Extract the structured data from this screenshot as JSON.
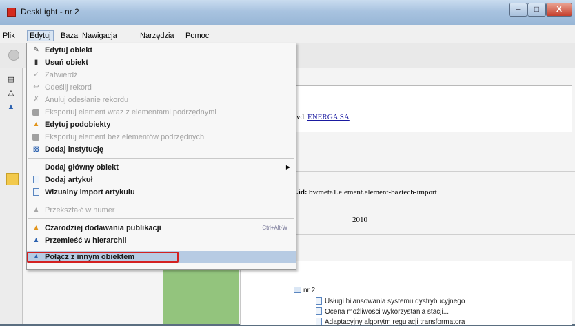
{
  "window": {
    "title": "DeskLight - nr 2",
    "min_glyph": "–",
    "max_glyph": "□",
    "close_glyph": "X"
  },
  "menubar": [
    "Plik",
    "Edytuj",
    "Baza",
    "Nawigacja",
    "Narzędzia",
    "Pomoc"
  ],
  "menubar_active": "Edytuj",
  "menu_items": [
    {
      "label": "Edytuj obiekt",
      "icon": "edit-icon",
      "state": "enabled"
    },
    {
      "label": "Usuń obiekt",
      "icon": "trash-icon",
      "state": "enabled"
    },
    {
      "label": "Zatwierdź",
      "icon": "checkmark-icon",
      "state": "disabled"
    },
    {
      "label": "Odeślij rekord",
      "icon": "send-back-icon",
      "state": "disabled"
    },
    {
      "label": "Anuluj odesłanie rekordu",
      "icon": "cancel-send-icon",
      "state": "disabled"
    },
    {
      "label": "Eksportuj element wraz z elementami podrzędnymi",
      "icon": "export-icon",
      "state": "disabled"
    },
    {
      "label": "Edytuj podobiekty",
      "icon": "wizard-icon",
      "state": "enabled"
    },
    {
      "label": "Eksportuj element bez elementów podrzędnych",
      "icon": "export-icon",
      "state": "disabled"
    },
    {
      "label": "Dodaj instytucję",
      "icon": "institution-icon",
      "state": "enabled"
    },
    {
      "label": "Dodaj główny obiekt",
      "icon": "",
      "state": "enabled",
      "submenu": true
    },
    {
      "label": "Dodaj artykuł",
      "icon": "document-icon",
      "state": "enabled"
    },
    {
      "label": "Wizualny import artykułu",
      "icon": "document-icon",
      "state": "enabled"
    },
    {
      "label": "Przekształć w numer",
      "icon": "hierarchy-icon",
      "state": "disabled"
    },
    {
      "label": "Czarodziej dodawania publikacji",
      "icon": "wizard-icon",
      "state": "enabled",
      "shortcut": "Ctrl+Alt-W"
    },
    {
      "label": "Przemieść w hierarchii",
      "icon": "hierarchy-icon",
      "state": "enabled"
    },
    {
      "label": "Połącz z innym obiektem",
      "icon": "hierarchy-icon",
      "state": "highlighted"
    }
  ],
  "content": {
    "publisher_prefix": "vd.",
    "publisher_link": "ENERGA SA",
    "id_label": ".id:",
    "id_value": "bwmeta1.element.element-baztech-import",
    "year": "2010"
  },
  "tree": {
    "root": "nr 2",
    "items": [
      "Usługi bilansowania systemu dystrybucyjnego",
      "Ocena możliwości wykorzystania stacji...",
      "Adaptacyjny algorytm regulacji transformatora"
    ]
  },
  "colors": {
    "highlight": "#b7cbe3",
    "annotation_box": "#d32020",
    "green_panel": "#93c47d",
    "link": "#1a1aa0"
  }
}
